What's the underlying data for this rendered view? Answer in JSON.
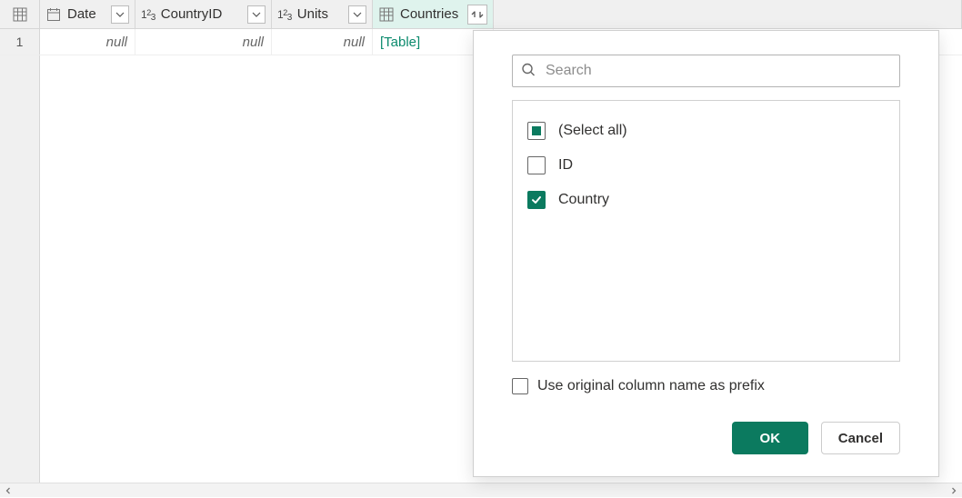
{
  "columns": {
    "date": {
      "name": "Date",
      "type": "date"
    },
    "country_id": {
      "name": "CountryID",
      "type": "number"
    },
    "units": {
      "name": "Units",
      "type": "number"
    },
    "countries": {
      "name": "Countries",
      "type": "table"
    }
  },
  "rows": [
    {
      "num": "1",
      "date": "null",
      "country_id": "null",
      "units": "null",
      "countries": "[Table]"
    }
  ],
  "flyout": {
    "search_placeholder": "Search",
    "options": {
      "select_all": {
        "label": "(Select all)",
        "state": "indeterminate"
      },
      "id": {
        "label": "ID",
        "state": "unchecked"
      },
      "country": {
        "label": "Country",
        "state": "checked"
      }
    },
    "prefix_label": "Use original column name as prefix",
    "prefix_checked": false,
    "ok_label": "OK",
    "cancel_label": "Cancel"
  },
  "colors": {
    "accent": "#0b7a5f",
    "col_highlight": "#dff3ed"
  }
}
